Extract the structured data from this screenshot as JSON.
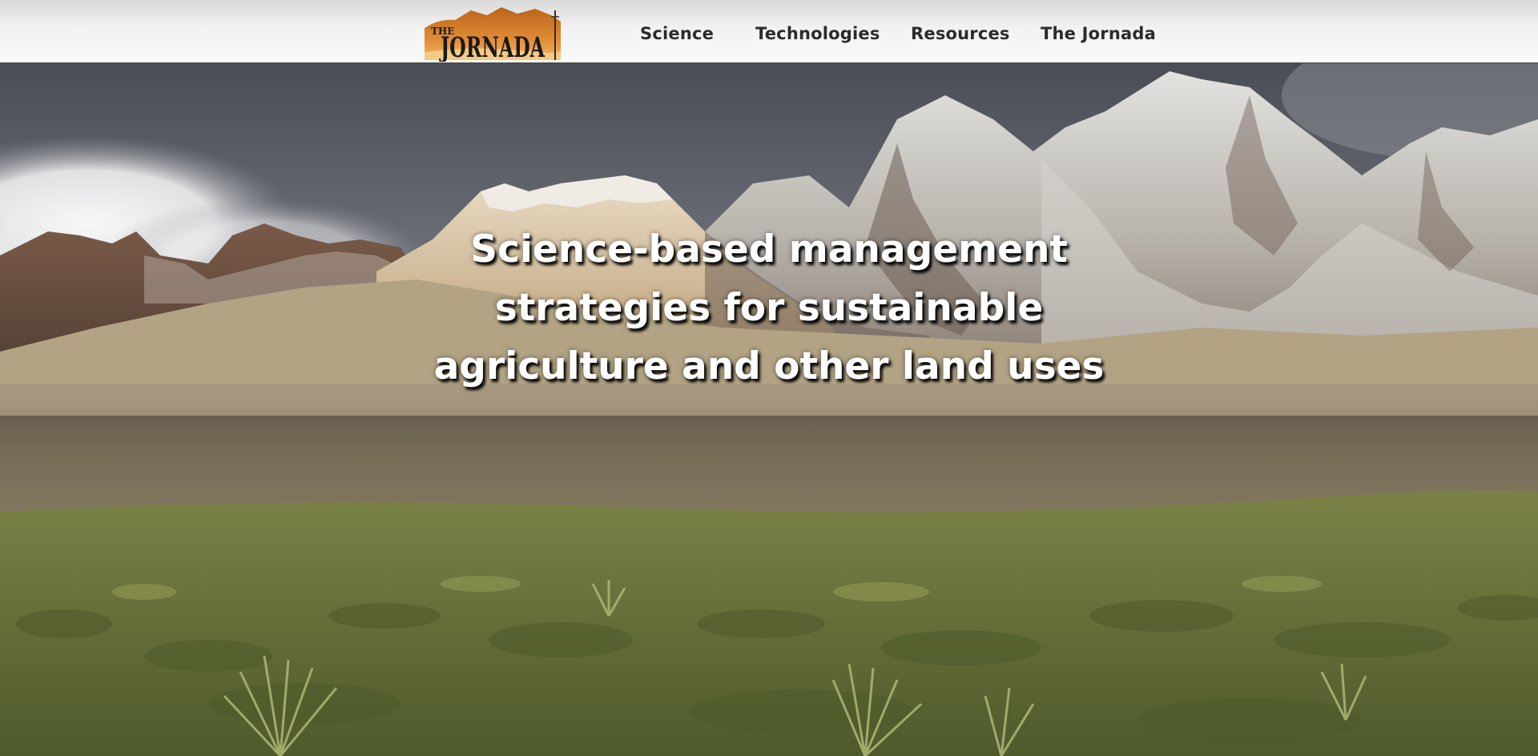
{
  "logo": {
    "text_small": "THE",
    "text_large": "JORNADA"
  },
  "nav": {
    "items": [
      {
        "label": "Science"
      },
      {
        "label": "Technologies"
      },
      {
        "label": "Resources"
      },
      {
        "label": "The Jornada"
      }
    ]
  },
  "hero": {
    "line1": "Science-based management",
    "line2": "strategies for sustainable",
    "line3": "agriculture and other land uses"
  },
  "colors": {
    "nav_text": "#2b2b2b",
    "logo_orange": "#d9822b",
    "hero_text": "#ffffff"
  }
}
